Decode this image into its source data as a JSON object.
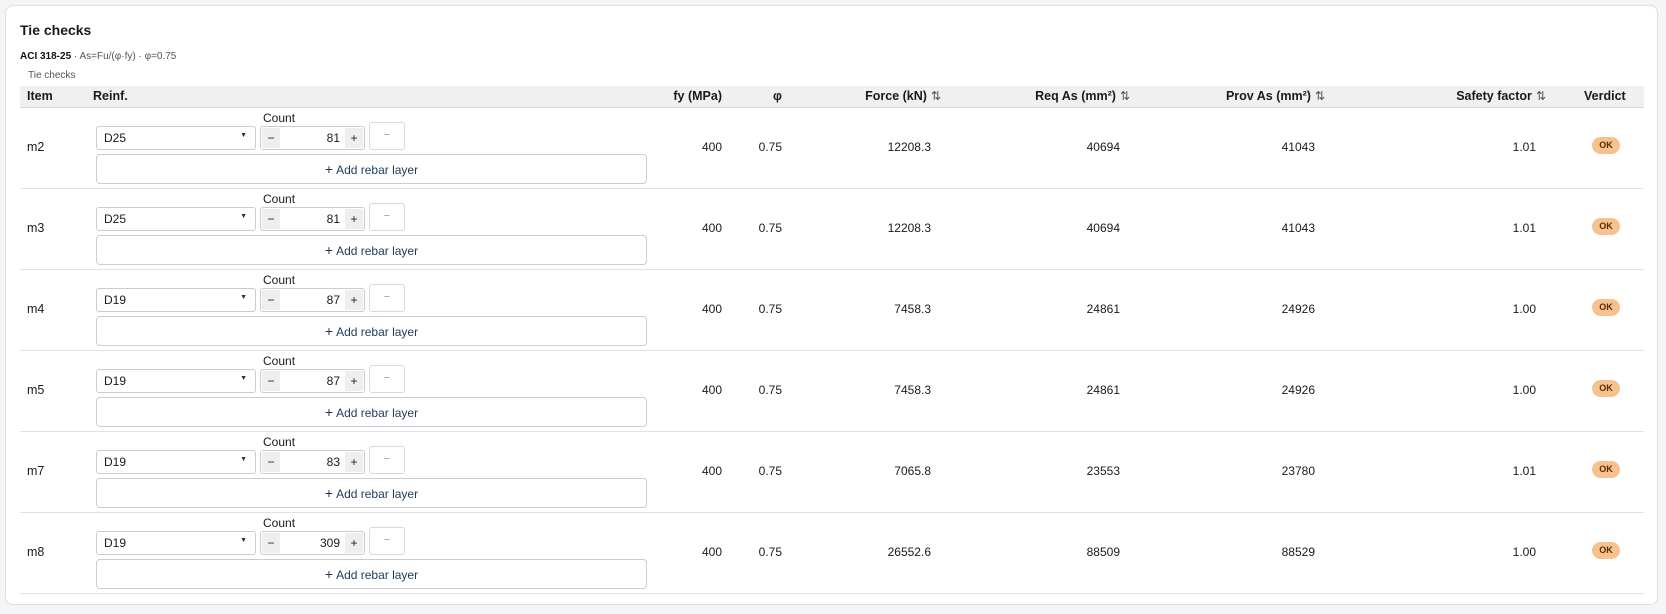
{
  "panel": {
    "title": "Tie checks",
    "subtitle_code": "ACI 318-25",
    "subtitle_rest": " · As=Fu/(φ·fy) · φ=0.75",
    "caption": "Tie checks"
  },
  "columns": {
    "item": "Item",
    "reinf": "Reinf.",
    "fy": "fy (MPa)",
    "phi": "φ",
    "force": "Force (kN)",
    "req_as": "Req As (mm²)",
    "prov_as": "Prov As (mm²)",
    "sf": "Safety factor",
    "verdict": "Verdict",
    "sort_icon": "⇅"
  },
  "labels": {
    "count": "Count",
    "add_layer": "Add rebar layer",
    "minus": "−",
    "plus": "+",
    "remove": "−"
  },
  "rows": [
    {
      "item": "m2",
      "bar": "D25",
      "count": "81",
      "fy": "400",
      "phi": "0.75",
      "force": "12208.3",
      "req_as": "40694",
      "prov_as": "41043",
      "sf": "1.01",
      "verdict": "OK"
    },
    {
      "item": "m3",
      "bar": "D25",
      "count": "81",
      "fy": "400",
      "phi": "0.75",
      "force": "12208.3",
      "req_as": "40694",
      "prov_as": "41043",
      "sf": "1.01",
      "verdict": "OK"
    },
    {
      "item": "m4",
      "bar": "D19",
      "count": "87",
      "fy": "400",
      "phi": "0.75",
      "force": "7458.3",
      "req_as": "24861",
      "prov_as": "24926",
      "sf": "1.00",
      "verdict": "OK"
    },
    {
      "item": "m5",
      "bar": "D19",
      "count": "87",
      "fy": "400",
      "phi": "0.75",
      "force": "7458.3",
      "req_as": "24861",
      "prov_as": "24926",
      "sf": "1.00",
      "verdict": "OK"
    },
    {
      "item": "m7",
      "bar": "D19",
      "count": "83",
      "fy": "400",
      "phi": "0.75",
      "force": "7065.8",
      "req_as": "23553",
      "prov_as": "23780",
      "sf": "1.01",
      "verdict": "OK"
    },
    {
      "item": "m8",
      "bar": "D19",
      "count": "309",
      "fy": "400",
      "phi": "0.75",
      "force": "26552.6",
      "req_as": "88509",
      "prov_as": "88529",
      "sf": "1.00",
      "verdict": "OK"
    }
  ],
  "colors": {
    "ok_badge": "#f6c28f",
    "header_bg": "#eef0f2"
  }
}
